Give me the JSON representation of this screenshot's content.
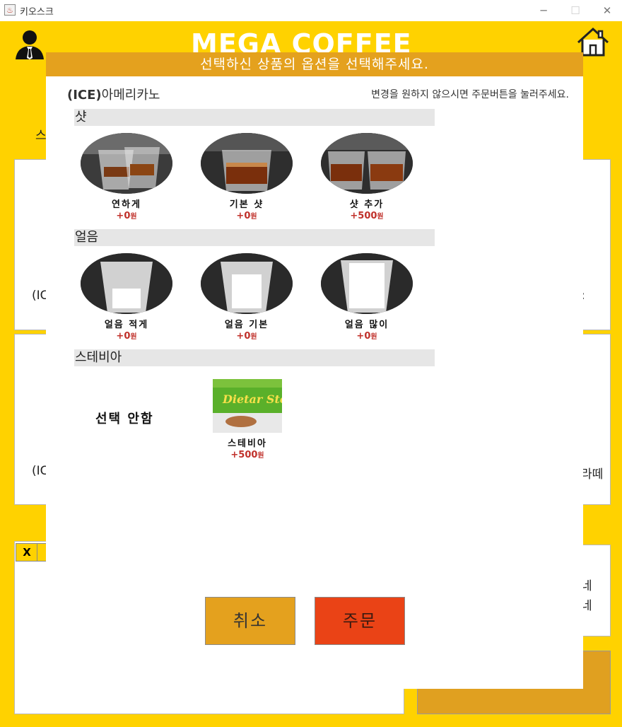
{
  "window": {
    "title": "키오스크",
    "minimize": "─",
    "maximize": "☐",
    "close": "✕"
  },
  "brand": {
    "logo": "MEGA COFFEE"
  },
  "background": {
    "left_texts": [
      "스",
      "(IC",
      "(IC"
    ],
    "right_texts": [
      ":",
      "라떼"
    ],
    "x_label": "X",
    "side_text": [
      "네",
      "네"
    ]
  },
  "dialog": {
    "header": "선택하신 상품의 옵션을 선택해주세요.",
    "product_prefix": "(ICE)",
    "product_name": "아메리카노",
    "hint": "변경을 원하지 않으시면 주문버튼을 눌러주세요.",
    "sections": [
      {
        "title": "샷",
        "options": [
          {
            "label": "연하게",
            "price": "+0",
            "unit": "원"
          },
          {
            "label": "기본 샷",
            "price": "+0",
            "unit": "원"
          },
          {
            "label": "샷 추가",
            "price": "+500",
            "unit": "원"
          }
        ]
      },
      {
        "title": "얼음",
        "options": [
          {
            "label": "얼음 적게",
            "price": "+0",
            "unit": "원"
          },
          {
            "label": "얼음 기본",
            "price": "+0",
            "unit": "원"
          },
          {
            "label": "얼음 많이",
            "price": "+0",
            "unit": "원"
          }
        ]
      },
      {
        "title": "스테비아",
        "none_label": "선택 안함",
        "options": [
          {
            "label": "스테비아",
            "price": "+500",
            "unit": "원",
            "product_text": "Dietar Stevia"
          }
        ]
      }
    ],
    "cancel_label": "취소",
    "order_label": "주문"
  },
  "colors": {
    "kiosk_bg": "#FFD200",
    "header": "#E4A11E",
    "cancel": "#E4A11E",
    "order": "#EA4316",
    "price": "#C0302A"
  }
}
